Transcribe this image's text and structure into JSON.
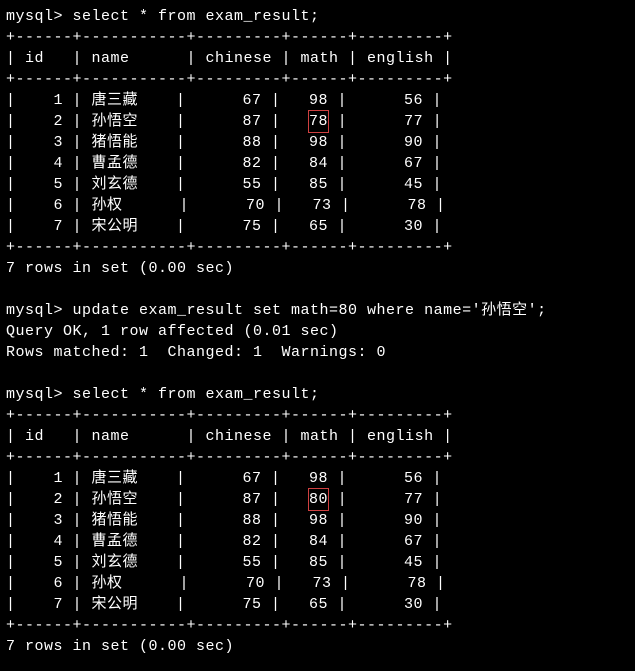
{
  "prompt_prefix": "mysql> ",
  "query1": "select * from exam_result;",
  "query2": "update exam_result set math=80 where name='孙悟空';",
  "query3": "select * from exam_result;",
  "response_ok": "Query OK, 1 row affected (0.01 sec)",
  "response_match": "Rows matched: 1  Changed: 1  Warnings: 0",
  "rows_status": "7 rows in set (0.00 sec)",
  "table_border": "+------+-----------+---------+------+---------+",
  "headers": {
    "id": "id",
    "name": "name",
    "chinese": "chinese",
    "math": "math",
    "english": "english"
  },
  "table1": {
    "rows": [
      {
        "id": "1",
        "name": "唐三藏",
        "chinese": "67",
        "math": "98",
        "english": "56",
        "highlight_math": false
      },
      {
        "id": "2",
        "name": "孙悟空",
        "chinese": "87",
        "math": "78",
        "english": "77",
        "highlight_math": true
      },
      {
        "id": "3",
        "name": "猪悟能",
        "chinese": "88",
        "math": "98",
        "english": "90",
        "highlight_math": false
      },
      {
        "id": "4",
        "name": "曹孟德",
        "chinese": "82",
        "math": "84",
        "english": "67",
        "highlight_math": false
      },
      {
        "id": "5",
        "name": "刘玄德",
        "chinese": "55",
        "math": "85",
        "english": "45",
        "highlight_math": false
      },
      {
        "id": "6",
        "name": "孙权",
        "chinese": "70",
        "math": "73",
        "english": "78",
        "highlight_math": false
      },
      {
        "id": "7",
        "name": "宋公明",
        "chinese": "75",
        "math": "65",
        "english": "30",
        "highlight_math": false
      }
    ]
  },
  "table2": {
    "rows": [
      {
        "id": "1",
        "name": "唐三藏",
        "chinese": "67",
        "math": "98",
        "english": "56",
        "highlight_math": false
      },
      {
        "id": "2",
        "name": "孙悟空",
        "chinese": "87",
        "math": "80",
        "english": "77",
        "highlight_math": true
      },
      {
        "id": "3",
        "name": "猪悟能",
        "chinese": "88",
        "math": "98",
        "english": "90",
        "highlight_math": false
      },
      {
        "id": "4",
        "name": "曹孟德",
        "chinese": "82",
        "math": "84",
        "english": "67",
        "highlight_math": false
      },
      {
        "id": "5",
        "name": "刘玄德",
        "chinese": "55",
        "math": "85",
        "english": "45",
        "highlight_math": false
      },
      {
        "id": "6",
        "name": "孙权",
        "chinese": "70",
        "math": "73",
        "english": "78",
        "highlight_math": false
      },
      {
        "id": "7",
        "name": "宋公明",
        "chinese": "75",
        "math": "65",
        "english": "30",
        "highlight_math": false
      }
    ]
  }
}
